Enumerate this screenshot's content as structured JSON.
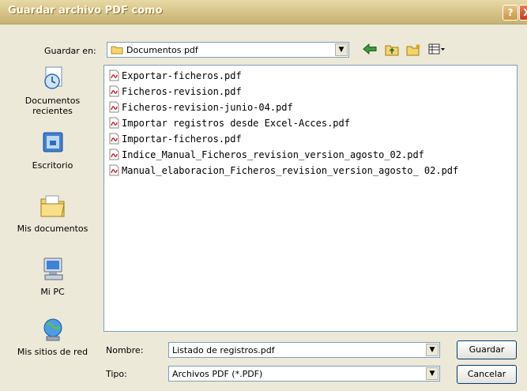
{
  "window": {
    "title": "Guardar archivo PDF como",
    "help_glyph": "?",
    "close_glyph": "X"
  },
  "toolbar": {
    "save_in_label": "Guardar en:",
    "location": "Documentos pdf",
    "back_icon": "back-arrow-icon",
    "up_icon": "up-folder-icon",
    "new_folder_icon": "new-folder-icon",
    "view_icon": "view-menu-icon"
  },
  "places": [
    {
      "label": "Documentos recientes",
      "icon": "recent-documents-icon"
    },
    {
      "label": "Escritorio",
      "icon": "desktop-icon"
    },
    {
      "label": "Mis documentos",
      "icon": "my-documents-icon"
    },
    {
      "label": "Mi PC",
      "icon": "my-computer-icon"
    },
    {
      "label": "Mis sitios de red",
      "icon": "network-places-icon"
    }
  ],
  "files": [
    "Exportar-ficheros.pdf",
    "Ficheros-revision.pdf",
    "Ficheros-revision-junio-04.pdf",
    "Importar registros desde Excel-Acces.pdf",
    "Importar-ficheros.pdf",
    "Indice_Manual_Ficheros_revision_version_agosto_02.pdf",
    "Manual_elaboracion_Ficheros_revision_version_agosto_ 02.pdf"
  ],
  "form": {
    "name_label": "Nombre:",
    "name_value": "Listado de registros.pdf",
    "type_label": "Tipo:",
    "type_value": "Archivos PDF (*.PDF)",
    "save_button": "Guardar",
    "cancel_button": "Cancelar"
  }
}
